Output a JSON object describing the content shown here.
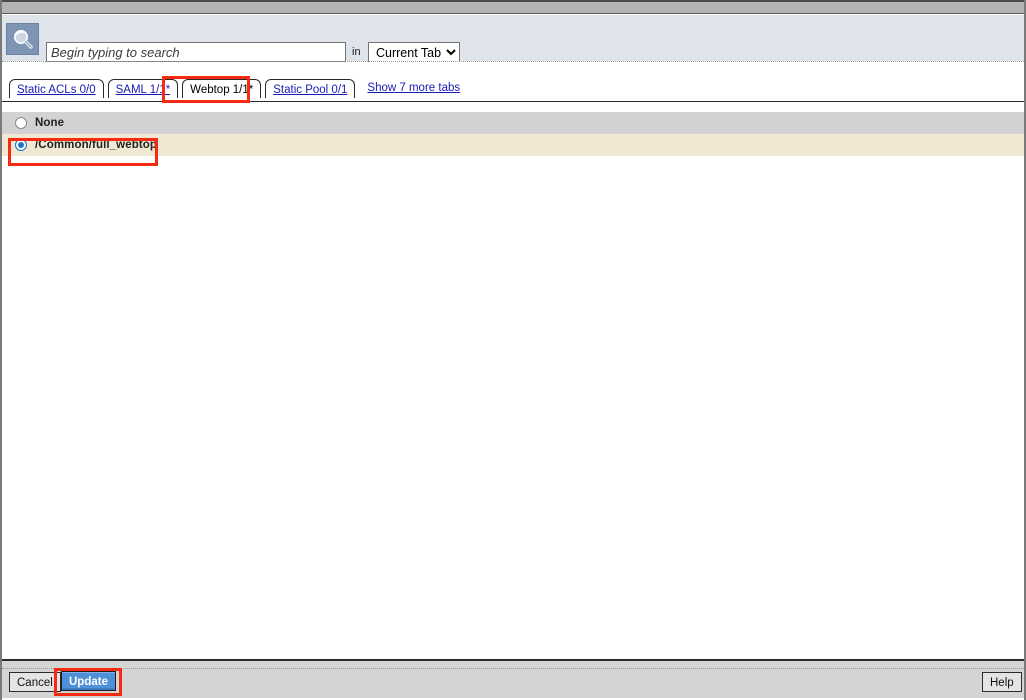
{
  "window": {
    "title_strip_color": "#b4b4b4"
  },
  "search": {
    "icon": "magnifier-icon",
    "placeholder": "Begin typing to search",
    "value": "",
    "in_label": "in",
    "scope_selected": "Current Tab",
    "scope_options": [
      "Current Tab"
    ]
  },
  "tabs": {
    "items": [
      {
        "label": "Static ACLs 0/0",
        "active": false
      },
      {
        "label": "SAML 1/1*",
        "active": false
      },
      {
        "label": "Webtop 1/1*",
        "active": true
      },
      {
        "label": "Static Pool 0/1",
        "active": false
      }
    ],
    "more_link": "Show 7 more tabs"
  },
  "options": {
    "items": [
      {
        "label": "None",
        "selected": false
      },
      {
        "label": "/Common/full_webtop",
        "selected": true
      }
    ]
  },
  "footer": {
    "cancel_label": "Cancel",
    "update_label": "Update",
    "help_label": "Help"
  },
  "colors": {
    "annotation": "#f52a13",
    "search_band": "#dfe4eb",
    "row_unselected": "#d2d2d2",
    "row_selected": "#f0e8d2",
    "update_button": "#4f91d8",
    "tab_link": "#1a1ab4"
  }
}
